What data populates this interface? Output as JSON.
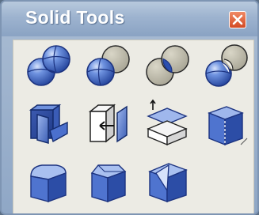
{
  "window": {
    "title": "Solid Tools",
    "close_icon": "close-icon"
  },
  "colors": {
    "title_text": "#ffffff",
    "close_button": "#e0603a",
    "icon_blue": "#4a72c8",
    "panel_bg": "#ecebe4"
  },
  "tools": [
    {
      "id": "boolean-union",
      "icon": "boolean-union-icon"
    },
    {
      "id": "boolean-difference",
      "icon": "boolean-difference-icon"
    },
    {
      "id": "boolean-intersection",
      "icon": "boolean-intersection-icon"
    },
    {
      "id": "boolean-split",
      "icon": "boolean-split-icon"
    },
    {
      "id": "extract-surface",
      "icon": "extract-surface-icon"
    },
    {
      "id": "move-face",
      "icon": "move-face-icon"
    },
    {
      "id": "extrude-face",
      "icon": "extrude-face-icon"
    },
    {
      "id": "split-edge",
      "icon": "split-edge-icon"
    },
    {
      "id": "fillet-edges",
      "icon": "fillet-edges-icon"
    },
    {
      "id": "chamfer-edges",
      "icon": "chamfer-edges-icon"
    },
    {
      "id": "cut-corner",
      "icon": "cut-corner-icon"
    }
  ]
}
